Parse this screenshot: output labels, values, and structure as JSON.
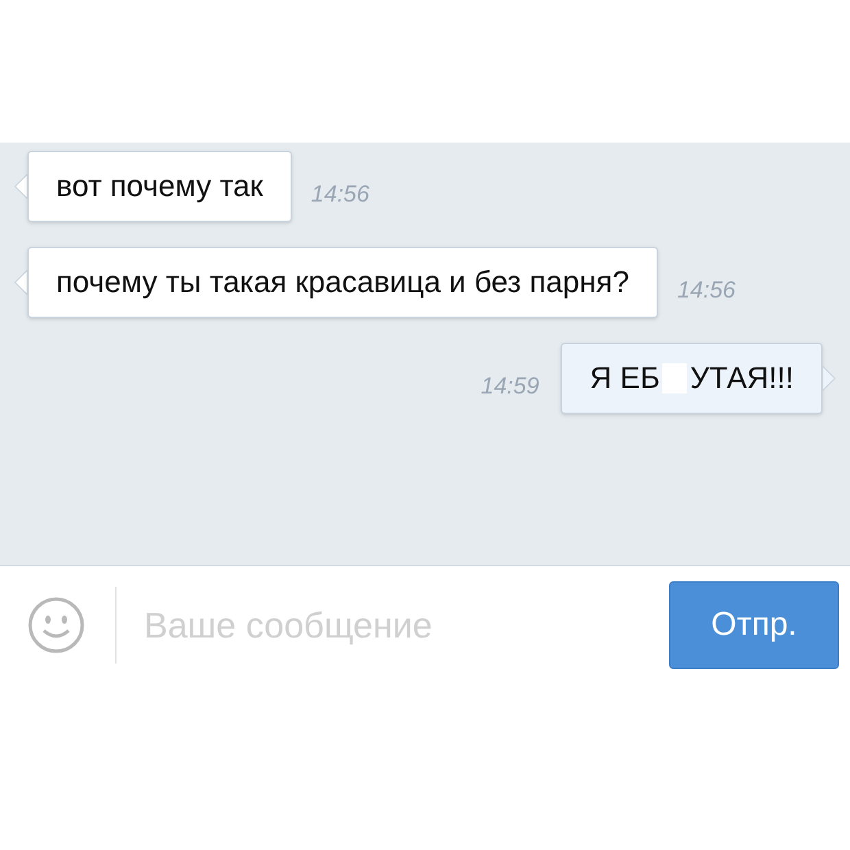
{
  "messages": [
    {
      "outgoing": false,
      "text_parts": [
        "вот почему так"
      ],
      "time": "14:56"
    },
    {
      "outgoing": false,
      "text_parts": [
        "почему ты такая красавица и без парня?"
      ],
      "time": "14:56"
    },
    {
      "outgoing": true,
      "text_parts": [
        "Я ЕБ",
        "УТАЯ!!!"
      ],
      "time": "14:59"
    }
  ],
  "composer": {
    "placeholder": "Ваше сообщение",
    "send_button": "Отпр."
  }
}
